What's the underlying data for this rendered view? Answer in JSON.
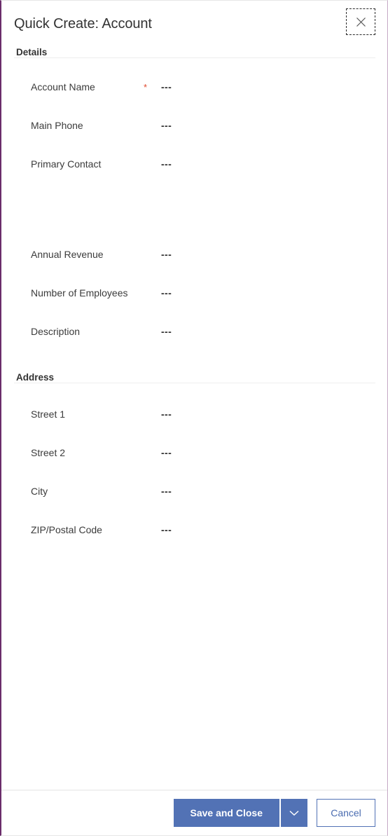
{
  "panel": {
    "title": "Quick Create: Account",
    "close_icon": "close-icon",
    "accent_border_color": "#6b2d6b",
    "required_marker_color": "#e04a2f",
    "empty_value": "---"
  },
  "sections": [
    {
      "id": "details",
      "header": "Details",
      "fields": [
        {
          "label": "Account Name",
          "required": "*",
          "value": "---"
        },
        {
          "label": "Main Phone",
          "required": "",
          "value": "---"
        },
        {
          "label": "Primary Contact",
          "required": "",
          "value": "---"
        },
        {
          "label": "Annual Revenue",
          "required": "",
          "value": "---"
        },
        {
          "label": "Number of Employees",
          "required": "",
          "value": "---"
        },
        {
          "label": "Description",
          "required": "",
          "value": "---"
        }
      ]
    },
    {
      "id": "address",
      "header": "Address",
      "fields": [
        {
          "label": "Street 1",
          "required": "",
          "value": "---"
        },
        {
          "label": "Street 2",
          "required": "",
          "value": "---"
        },
        {
          "label": "City",
          "required": "",
          "value": "---"
        },
        {
          "label": "ZIP/Postal Code",
          "required": "",
          "value": "---"
        }
      ]
    }
  ],
  "footer": {
    "save_label": "Save and Close",
    "save_dropdown_icon": "chevron-down-icon",
    "cancel_label": "Cancel",
    "primary_color": "#5272b5"
  }
}
